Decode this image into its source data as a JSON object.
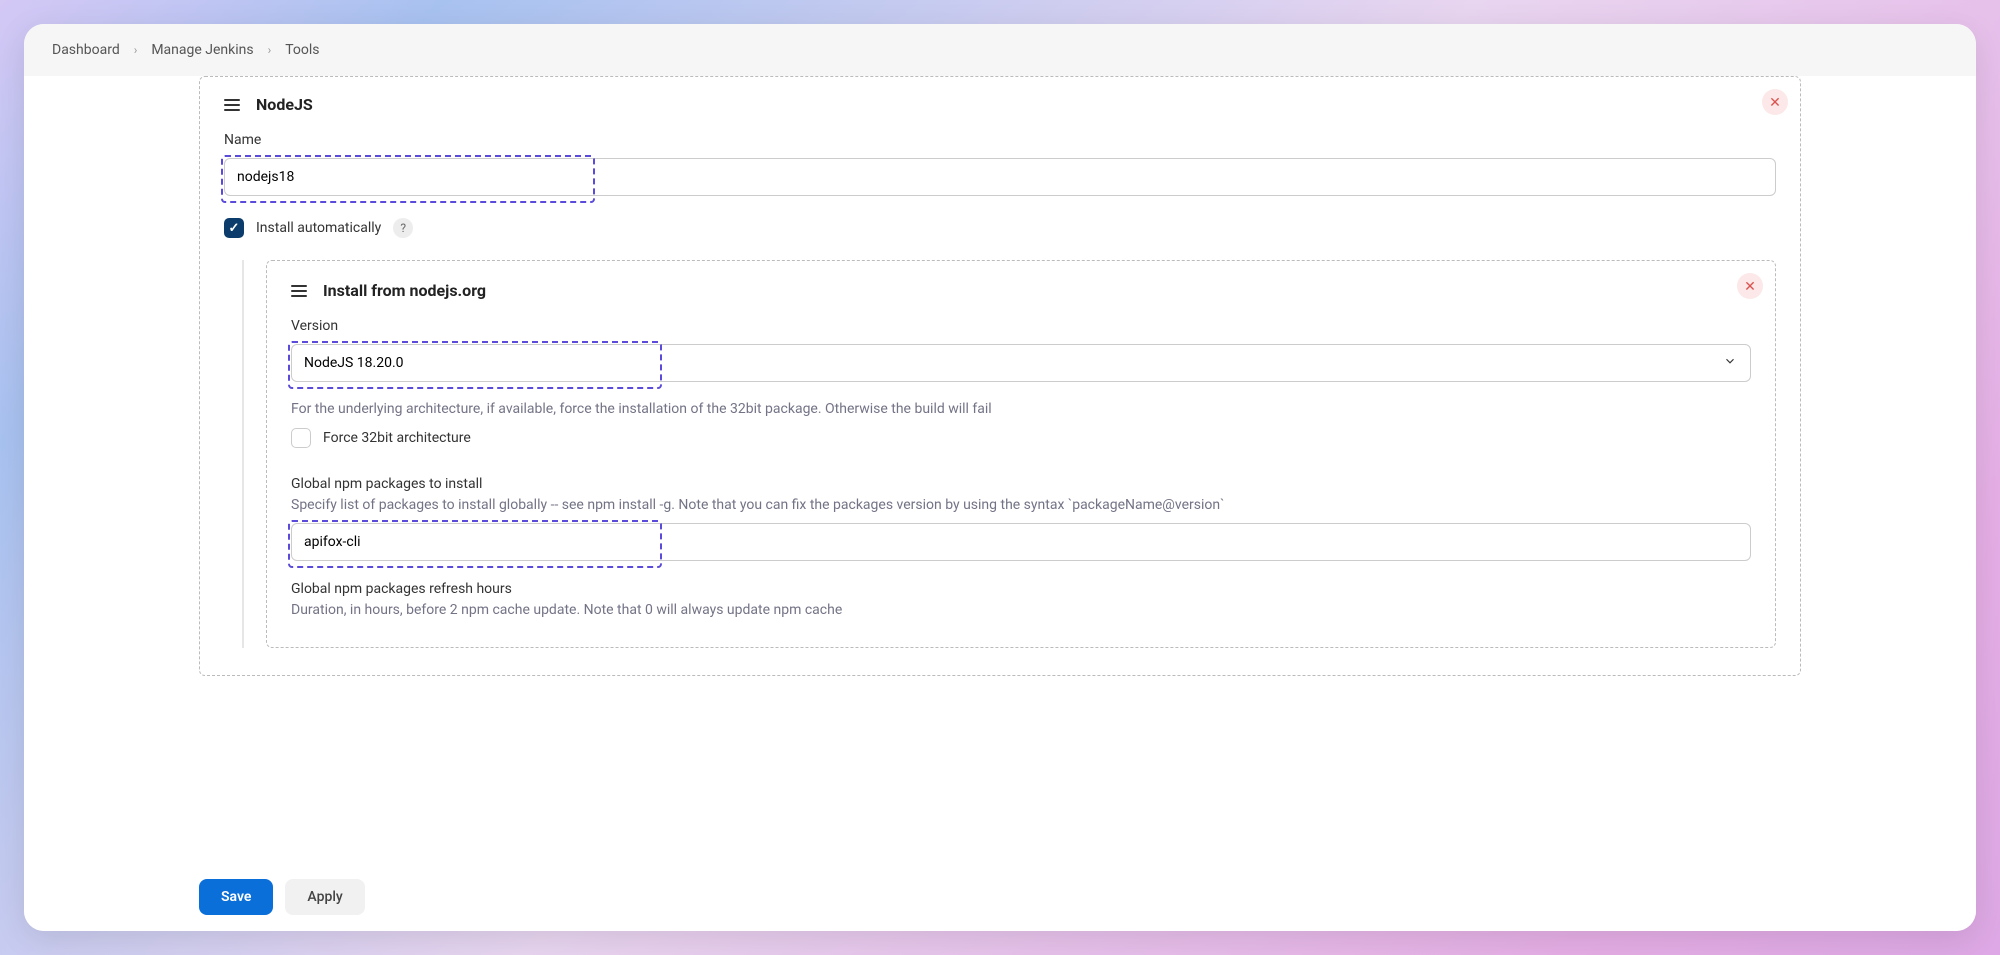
{
  "breadcrumb": {
    "items": [
      "Dashboard",
      "Manage Jenkins",
      "Tools"
    ]
  },
  "nodejs": {
    "title": "NodeJS",
    "name_label": "Name",
    "name_value": "nodejs18",
    "install_auto_label": "Install automatically",
    "install_auto_checked": true
  },
  "installer": {
    "title": "Install from nodejs.org",
    "version_label": "Version",
    "version_value": "NodeJS 18.20.0",
    "force32_help": "For the underlying architecture, if available, force the installation of the 32bit package. Otherwise the build will fail",
    "force32_label": "Force 32bit architecture",
    "global_pkg_label": "Global npm packages to install",
    "global_pkg_help": "Specify list of packages to install globally -- see npm install -g. Note that you can fix the packages version by using the syntax `packageName@version`",
    "global_pkg_value": "apifox-cli",
    "refresh_label": "Global npm packages refresh hours",
    "refresh_help": "Duration, in hours, before 2 npm cache update. Note that 0 will always update npm cache"
  },
  "actions": {
    "save": "Save",
    "apply": "Apply"
  }
}
